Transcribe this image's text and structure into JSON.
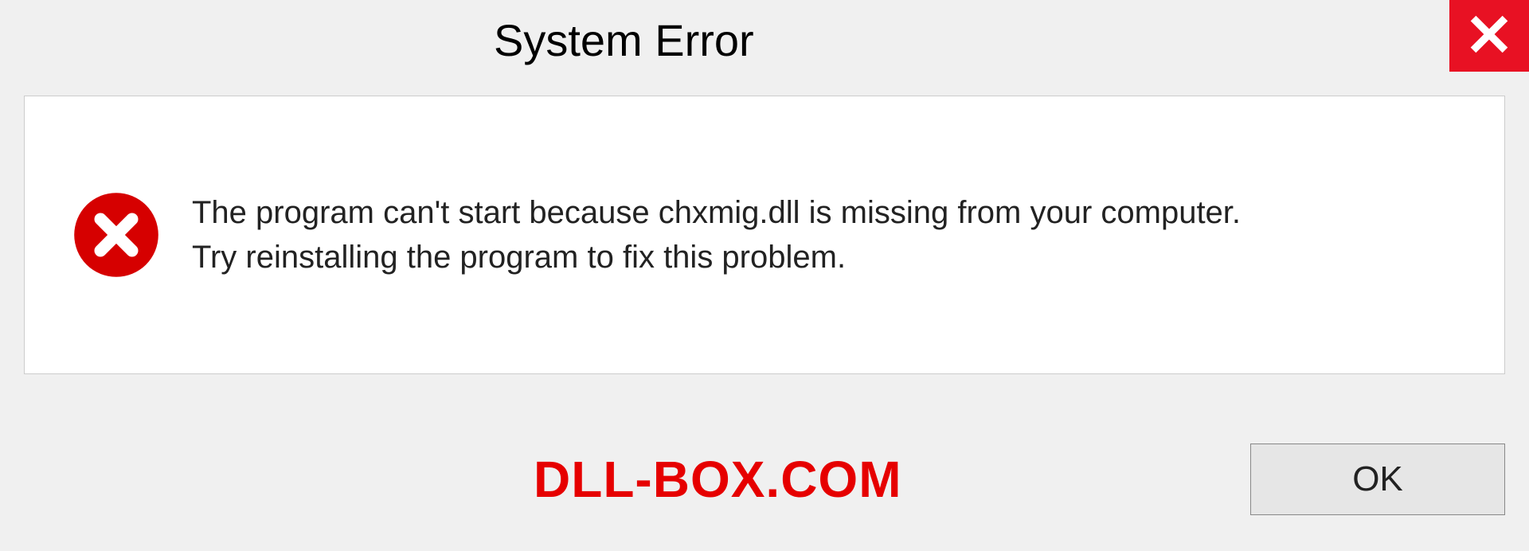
{
  "dialog": {
    "title": "System Error",
    "message": {
      "line1": "The program can't start because chxmig.dll is missing from your computer.",
      "line2": "Try reinstalling the program to fix this problem."
    },
    "ok_label": "OK"
  },
  "watermark": "DLL-BOX.COM",
  "colors": {
    "close_bg": "#e81123",
    "error_icon": "#d60000",
    "watermark": "#e60000"
  }
}
